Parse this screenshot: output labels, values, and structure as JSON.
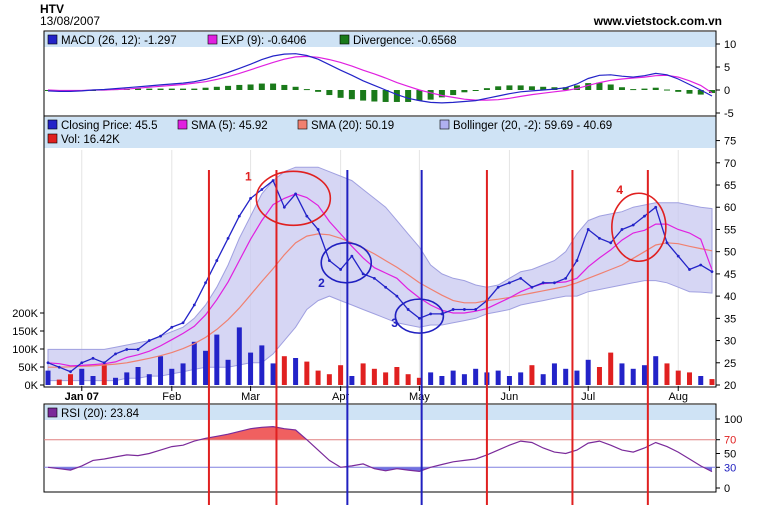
{
  "header": {
    "symbol": "HTV",
    "date": "13/08/2007",
    "site": "www.vietstock.com.vn"
  },
  "macd_panel": {
    "legend": [
      {
        "label": "MACD (26, 12): -1.297",
        "color": "#2323c8"
      },
      {
        "label": "EXP (9): -0.6406",
        "color": "#e020e0"
      },
      {
        "label": "Divergence: -0.6568",
        "color": "#1a7a1a"
      }
    ],
    "yticks": [
      "10",
      "5",
      "0",
      "-5"
    ]
  },
  "price_panel": {
    "legend": [
      {
        "label": "Closing Price: 45.5",
        "color": "#2323c8"
      },
      {
        "label": "SMA (5): 45.92",
        "color": "#e020e0"
      },
      {
        "label": "SMA (20): 50.19",
        "color": "#f08070"
      },
      {
        "label": "Bollinger (20, -2): 59.69 - 40.69",
        "color": "#b0b0f0"
      },
      {
        "label": "Vol: 16.42K",
        "color": "#e02020"
      }
    ],
    "yticks": [
      "75",
      "70",
      "65",
      "60",
      "55",
      "50",
      "45",
      "40",
      "35",
      "30",
      "25",
      "20"
    ],
    "vol_ticks": [
      "200K",
      "150K",
      "100K",
      "50K",
      "0K"
    ],
    "month_labels": [
      "Jan 07",
      "Feb",
      "Mar",
      "Apr",
      "May",
      "Jun",
      "Jul",
      "Aug"
    ]
  },
  "rsi_panel": {
    "legend": [
      {
        "label": "RSI (20): 23.84",
        "color": "#7a2a9a"
      }
    ],
    "yticks": [
      "100",
      "70",
      "50",
      "30",
      "0"
    ]
  },
  "annotations": [
    {
      "label": "1",
      "color": "#e02020"
    },
    {
      "label": "2",
      "color": "#2020c0"
    },
    {
      "label": "3",
      "color": "#2020c0"
    },
    {
      "label": "4",
      "color": "#e02020"
    }
  ],
  "chart_data": {
    "type": "line",
    "title": "HTV",
    "dates": [
      "2006-12-20",
      "2006-12-23",
      "2006-12-27",
      "2007-01-01",
      "2007-01-05",
      "2007-01-09",
      "2007-01-13",
      "2007-01-17",
      "2007-01-21",
      "2007-01-25",
      "2007-01-29",
      "2007-02-02",
      "2007-02-06",
      "2007-02-10",
      "2007-02-14",
      "2007-02-18",
      "2007-02-22",
      "2007-02-26",
      "2007-03-02",
      "2007-03-06",
      "2007-03-10",
      "2007-03-14",
      "2007-03-18",
      "2007-03-22",
      "2007-03-26",
      "2007-03-30",
      "2007-04-03",
      "2007-04-07",
      "2007-04-11",
      "2007-04-15",
      "2007-04-19",
      "2007-04-23",
      "2007-04-27",
      "2007-05-01",
      "2007-05-05",
      "2007-05-09",
      "2007-05-13",
      "2007-05-17",
      "2007-05-21",
      "2007-05-25",
      "2007-05-29",
      "2007-06-02",
      "2007-06-06",
      "2007-06-10",
      "2007-06-14",
      "2007-06-18",
      "2007-06-22",
      "2007-06-26",
      "2007-06-30",
      "2007-07-04",
      "2007-07-08",
      "2007-07-12",
      "2007-07-16",
      "2007-07-20",
      "2007-07-24",
      "2007-07-28",
      "2007-08-01",
      "2007-08-05",
      "2007-08-09",
      "2007-08-13"
    ],
    "series": [
      {
        "name": "Closing Price",
        "values": [
          25,
          24,
          23,
          25,
          26,
          25,
          27,
          28,
          28,
          30,
          31,
          33,
          34,
          38,
          43,
          48,
          53,
          58,
          62,
          64,
          66,
          60,
          63,
          58,
          55,
          48,
          46,
          49,
          45,
          44,
          42,
          40,
          37,
          35,
          36,
          36,
          37,
          37,
          37,
          39,
          42,
          43,
          44,
          42,
          43,
          43,
          44,
          48,
          55,
          53,
          52,
          55,
          56,
          58,
          60,
          52,
          49,
          46,
          47,
          45.5
        ]
      },
      {
        "name": "SMA (5)",
        "values": [
          25,
          24.8,
          24.3,
          24.4,
          24.6,
          24.8,
          25.2,
          26.2,
          26.8,
          27.6,
          28.8,
          30.2,
          31.6,
          33.2,
          35.8,
          39.2,
          43.2,
          48,
          52.8,
          57,
          60.6,
          62,
          63,
          62.2,
          60.4,
          56.8,
          54,
          51.2,
          48.6,
          46.4,
          45.2,
          44,
          41.6,
          39.6,
          38,
          36.8,
          36.2,
          36.2,
          36.6,
          37.2,
          38.4,
          39.6,
          41,
          42,
          42.8,
          43,
          43.2,
          44,
          46.6,
          48.6,
          50.4,
          52.6,
          54.2,
          54.8,
          56.2,
          56.2,
          55,
          54.2,
          52.8,
          45.92
        ]
      },
      {
        "name": "SMA (20)",
        "values": [
          24,
          24,
          24.1,
          24.2,
          24.3,
          24.5,
          24.7,
          25,
          25.5,
          26,
          26.6,
          27.3,
          28.2,
          29.3,
          30.7,
          32.5,
          34.7,
          37.3,
          40.3,
          43.3,
          46.2,
          49.3,
          52,
          53.5,
          54,
          53.8,
          53,
          52,
          50.8,
          49.5,
          48,
          46.5,
          44.8,
          43,
          41.6,
          40.2,
          39,
          38.5,
          38.5,
          39,
          39.3,
          39.7,
          40.2,
          40.7,
          41.2,
          41.7,
          42.2,
          43,
          44,
          45,
          46,
          47,
          48.5,
          50,
          51.5,
          52,
          51.8,
          51.2,
          50.7,
          50.19
        ]
      },
      {
        "name": "Bollinger upper",
        "values": [
          28,
          28,
          28,
          28,
          28,
          28,
          28.5,
          29,
          29.5,
          30,
          31,
          32,
          33,
          35,
          38,
          42,
          47,
          53,
          58,
          63,
          66,
          68,
          69,
          69,
          69,
          68,
          67,
          66,
          64,
          62,
          60,
          57,
          54,
          51,
          47,
          45,
          44,
          43.5,
          42.5,
          42,
          42.5,
          44,
          45.5,
          46,
          47,
          48,
          50,
          54,
          57,
          58,
          58.5,
          59,
          60,
          60.5,
          61,
          61,
          61,
          60.5,
          60,
          59.69
        ]
      },
      {
        "name": "Bollinger lower",
        "values": [
          21,
          21,
          21,
          21,
          21,
          21,
          21,
          21.5,
          21.5,
          22,
          22,
          22.5,
          23,
          23.5,
          24,
          24,
          24,
          24.5,
          25,
          25,
          27,
          30,
          33,
          37,
          39,
          40,
          39,
          38,
          37,
          36,
          35,
          34,
          33.5,
          33,
          33.5,
          33.5,
          34,
          34.5,
          35,
          36,
          36.5,
          37,
          38,
          38.5,
          39,
          39.5,
          40,
          40,
          41,
          41.5,
          42,
          42.5,
          43,
          43.5,
          43.5,
          43,
          42,
          41,
          40.9,
          40.69
        ]
      },
      {
        "name": "Vol",
        "values": [
          40,
          15,
          30,
          45,
          25,
          60,
          20,
          35,
          50,
          30,
          80,
          45,
          60,
          120,
          95,
          140,
          70,
          160,
          90,
          110,
          60,
          80,
          75,
          65,
          40,
          30,
          55,
          25,
          60,
          45,
          35,
          50,
          30,
          20,
          35,
          25,
          40,
          30,
          45,
          35,
          40,
          25,
          35,
          55,
          30,
          60,
          45,
          40,
          70,
          50,
          90,
          60,
          45,
          55,
          80,
          60,
          40,
          35,
          25,
          16.42
        ]
      },
      {
        "name": "MACD (26, 12)",
        "values": [
          -0.2,
          -0.3,
          -0.3,
          -0.2,
          0,
          0.1,
          0.3,
          0.5,
          0.7,
          0.9,
          1.1,
          1.3,
          1.5,
          1.8,
          2.3,
          3,
          3.8,
          4.7,
          5.6,
          6.6,
          7.4,
          7.8,
          7.9,
          7.5,
          6.7,
          5.5,
          4.3,
          3.2,
          2,
          1,
          0,
          -1,
          -1.8,
          -2.3,
          -2.7,
          -2.8,
          -2.7,
          -2.5,
          -2.3,
          -1.8,
          -1.3,
          -0.8,
          -0.4,
          -0.2,
          0,
          0.2,
          0.5,
          1.3,
          2.5,
          3.2,
          3.3,
          3,
          2.8,
          3.1,
          3.6,
          3.3,
          2.4,
          1.2,
          0,
          -1.297
        ]
      },
      {
        "name": "EXP (9)",
        "values": [
          0,
          -0.1,
          -0.1,
          -0.1,
          0,
          0,
          0.1,
          0.2,
          0.4,
          0.6,
          0.8,
          1,
          1.2,
          1.5,
          1.8,
          2.3,
          2.9,
          3.6,
          4.4,
          5.2,
          6,
          6.7,
          7.2,
          7.3,
          7.1,
          6.6,
          6,
          5.2,
          4.3,
          3.5,
          2.6,
          1.6,
          0.8,
          0,
          -0.6,
          -1.2,
          -1.6,
          -2,
          -2.2,
          -2.2,
          -2.1,
          -1.8,
          -1.4,
          -1,
          -0.7,
          -0.4,
          -0.1,
          0.3,
          1,
          1.6,
          2.1,
          2.4,
          2.6,
          2.8,
          3.1,
          3.2,
          2.8,
          2,
          1,
          -0.6406
        ]
      },
      {
        "name": "RSI (20)",
        "values": [
          30,
          28,
          26,
          32,
          40,
          42,
          45,
          48,
          47,
          50,
          55,
          60,
          62,
          68,
          72,
          75,
          78,
          82,
          86,
          88,
          89,
          86,
          84,
          70,
          55,
          40,
          30,
          32,
          35,
          28,
          25,
          28,
          26,
          24,
          30,
          34,
          38,
          40,
          42,
          48,
          55,
          62,
          68,
          66,
          58,
          52,
          50,
          55,
          65,
          68,
          62,
          55,
          52,
          58,
          66,
          60,
          52,
          42,
          32,
          23.84
        ]
      }
    ]
  }
}
